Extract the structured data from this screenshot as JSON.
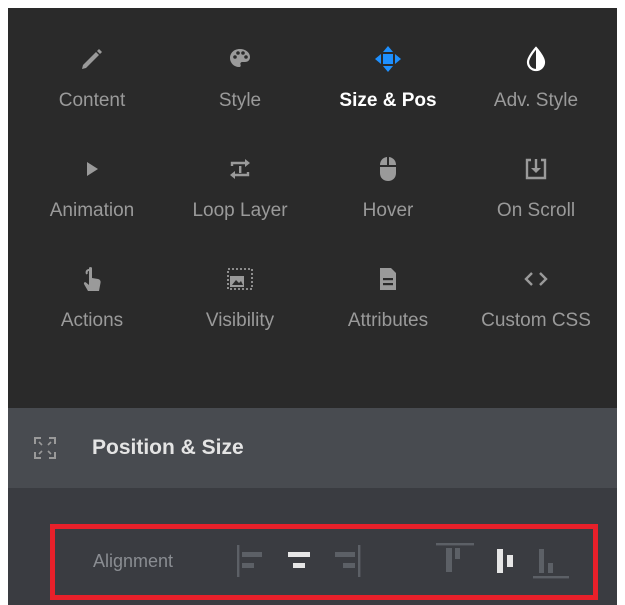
{
  "tabs": [
    {
      "label": "Content",
      "icon": "pencil-icon",
      "active": false
    },
    {
      "label": "Style",
      "icon": "palette-icon",
      "active": false
    },
    {
      "label": "Size & Pos",
      "icon": "move-arrows-icon",
      "active": true
    },
    {
      "label": "Adv. Style",
      "icon": "contrast-drop-icon",
      "active": false
    },
    {
      "label": "Animation",
      "icon": "play-icon",
      "active": false
    },
    {
      "label": "Loop Layer",
      "icon": "loop-icon",
      "active": false
    },
    {
      "label": "Hover",
      "icon": "mouse-icon",
      "active": false
    },
    {
      "label": "On Scroll",
      "icon": "scroll-download-icon",
      "active": false
    },
    {
      "label": "Actions",
      "icon": "tap-hand-icon",
      "active": false
    },
    {
      "label": "Visibility",
      "icon": "image-frame-icon",
      "active": false
    },
    {
      "label": "Attributes",
      "icon": "document-icon",
      "active": false
    },
    {
      "label": "Custom CSS",
      "icon": "code-brackets-icon",
      "active": false
    }
  ],
  "section": {
    "title": "Position & Size",
    "icon": "expand-corners-icon"
  },
  "alignment": {
    "label": "Alignment",
    "horizontal": [
      "align-left-icon",
      "align-center-icon",
      "align-right-icon"
    ],
    "vertical": [
      "align-top-icon",
      "align-middle-icon",
      "align-bottom-icon"
    ]
  },
  "colors": {
    "panel_bg": "#2a2a2a",
    "header_bg": "#484b50",
    "body_bg": "#3a3c41",
    "active_icon": "#1e90ff",
    "highlight_border": "#e8202a"
  }
}
